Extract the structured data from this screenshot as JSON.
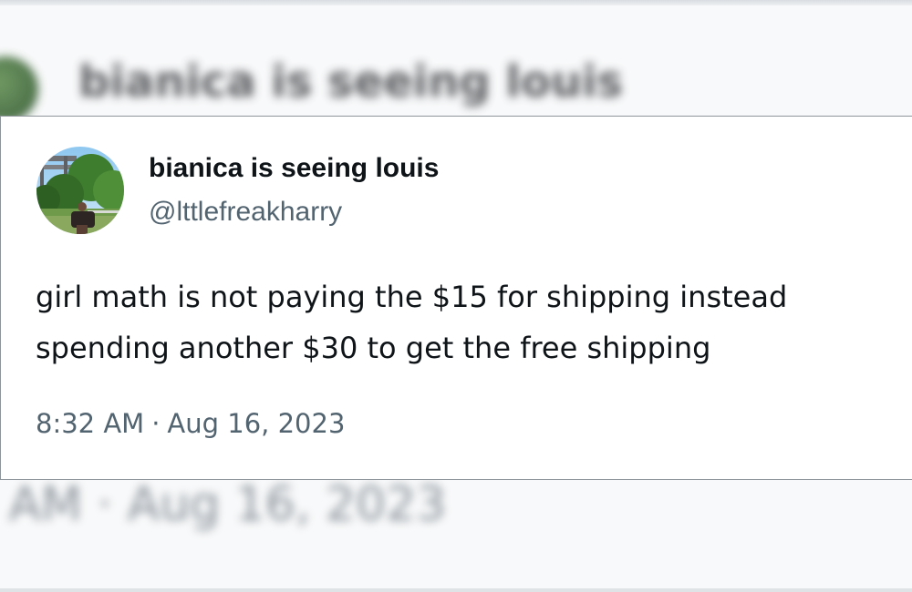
{
  "tweet": {
    "display_name": "bianica is seeing louis",
    "handle": "@lttlefreakharry",
    "text_lines": [
      "girl math is not paying the $15 for shipping instead",
      "spending another $30 to get the free shipping"
    ],
    "time": "8:32 AM",
    "separator": "·",
    "date": "Aug 16, 2023",
    "avatar_icon": "profile-photo-park-bridge"
  },
  "background": {
    "name_blurred": "bianica is seeing louis",
    "date_blurred": "2 AM · Aug 16, 2023"
  },
  "colors": {
    "text_primary": "#0f1419",
    "text_secondary": "#536471",
    "card_bg": "#ffffff",
    "card_border": "#8e969c"
  }
}
